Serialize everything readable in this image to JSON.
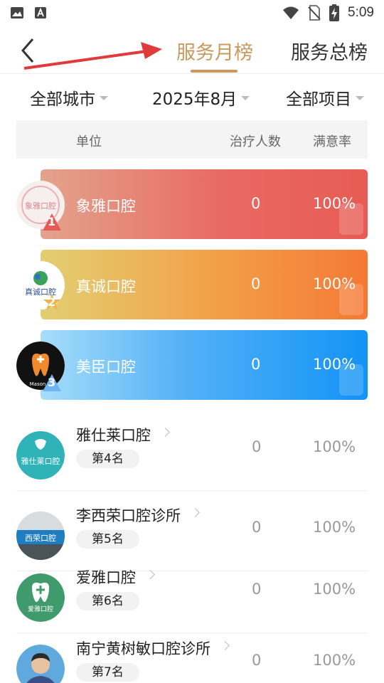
{
  "status_bar": {
    "time": "5:09",
    "icons": [
      "image-icon",
      "font-a-icon",
      "wifi-icon",
      "no-sim-icon",
      "battery-charging-icon"
    ]
  },
  "header": {
    "back_icon": "back-chevron-icon",
    "tabs": [
      {
        "label": "服务月榜",
        "active": true
      },
      {
        "label": "服务总榜",
        "active": false
      }
    ],
    "accent_color": "#c9995e"
  },
  "filters": {
    "city": "全部城市",
    "month": "2025年8月",
    "item": "全部项目"
  },
  "table": {
    "columns": [
      "单位",
      "治疗人数",
      "满意率"
    ],
    "top3": [
      {
        "rank": "1",
        "name": "象雅口腔",
        "count": "0",
        "rate": "100%",
        "avatar_text": "象雅口腔",
        "color": "#e85b55"
      },
      {
        "rank": "2",
        "name": "真诚口腔",
        "count": "0",
        "rate": "100%",
        "avatar_text": "真诚口腔",
        "color": "#f47934"
      },
      {
        "rank": "3",
        "name": "美臣口腔",
        "count": "0",
        "rate": "100%",
        "avatar_text": "Mason",
        "color": "#1293f6"
      }
    ],
    "rows": [
      {
        "rank_label": "第4名",
        "name": "雅仕莱口腔",
        "count": "0",
        "rate": "100%",
        "avatar_text": "雅仕莱口腔"
      },
      {
        "rank_label": "第5名",
        "name": "李西荣口腔诊所",
        "count": "0",
        "rate": "100%",
        "avatar_text": "西荣口腔"
      },
      {
        "rank_label": "第6名",
        "name": "爱雅口腔",
        "count": "0",
        "rate": "100%",
        "avatar_text": "爱雅口腔"
      },
      {
        "rank_label": "第7名",
        "name": "南宁黄树敏口腔诊所",
        "count": "0",
        "rate": "100%",
        "avatar_text": ""
      }
    ]
  }
}
